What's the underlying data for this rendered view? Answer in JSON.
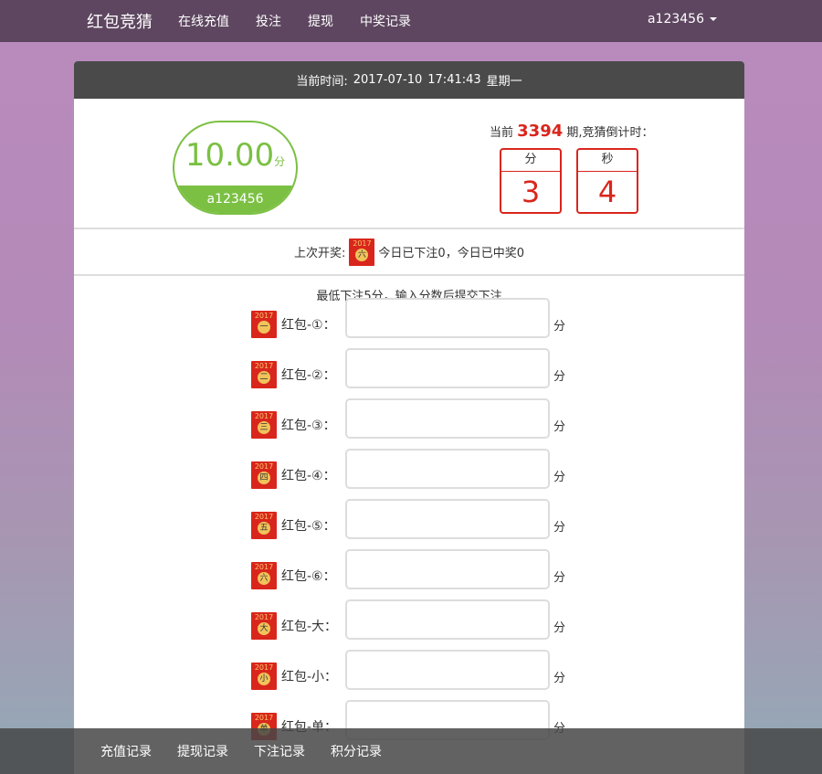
{
  "nav": {
    "brand": "红包竞猜",
    "links": [
      "在线充值",
      "投注",
      "提现",
      "中奖记录"
    ],
    "user": "a123456"
  },
  "header": {
    "time_label": "当前时间:",
    "date": "2017-07-10",
    "time": "17:41:43",
    "weekday": "星期一"
  },
  "score": {
    "value": "10.00",
    "unit": "分",
    "username": "a123456"
  },
  "period": {
    "prefix": "当前",
    "number": "3394",
    "suffix": "期,竞猜倒计时：",
    "minutes_label": "分",
    "minutes": "3",
    "seconds_label": "秒",
    "seconds": "4"
  },
  "last_draw": {
    "label": "上次开奖:",
    "result_glyph": "六",
    "summary": "今日已下注0，今日已中奖0"
  },
  "envelope_year": "2017",
  "form": {
    "hint": "最低下注5分，输入分数后提交下注",
    "unit": "分",
    "rows": [
      {
        "glyph": "一",
        "label": "红包-①：",
        "value": ""
      },
      {
        "glyph": "二",
        "label": "红包-②：",
        "value": ""
      },
      {
        "glyph": "三",
        "label": "红包-③：",
        "value": ""
      },
      {
        "glyph": "四",
        "label": "红包-④：",
        "value": ""
      },
      {
        "glyph": "五",
        "label": "红包-⑤：",
        "value": ""
      },
      {
        "glyph": "六",
        "label": "红包-⑥：",
        "value": ""
      },
      {
        "glyph": "大",
        "label": "红包-大：",
        "value": ""
      },
      {
        "glyph": "小",
        "label": "红包-小：",
        "value": ""
      },
      {
        "glyph": "单",
        "label": "红包-单：",
        "value": ""
      }
    ]
  },
  "bottom_bar": {
    "links": [
      "充值记录",
      "提现记录",
      "下注记录",
      "积分记录"
    ]
  },
  "colors": {
    "accent_green": "#7bc043",
    "accent_red": "#d9261c",
    "navbar": "#5e4660"
  }
}
